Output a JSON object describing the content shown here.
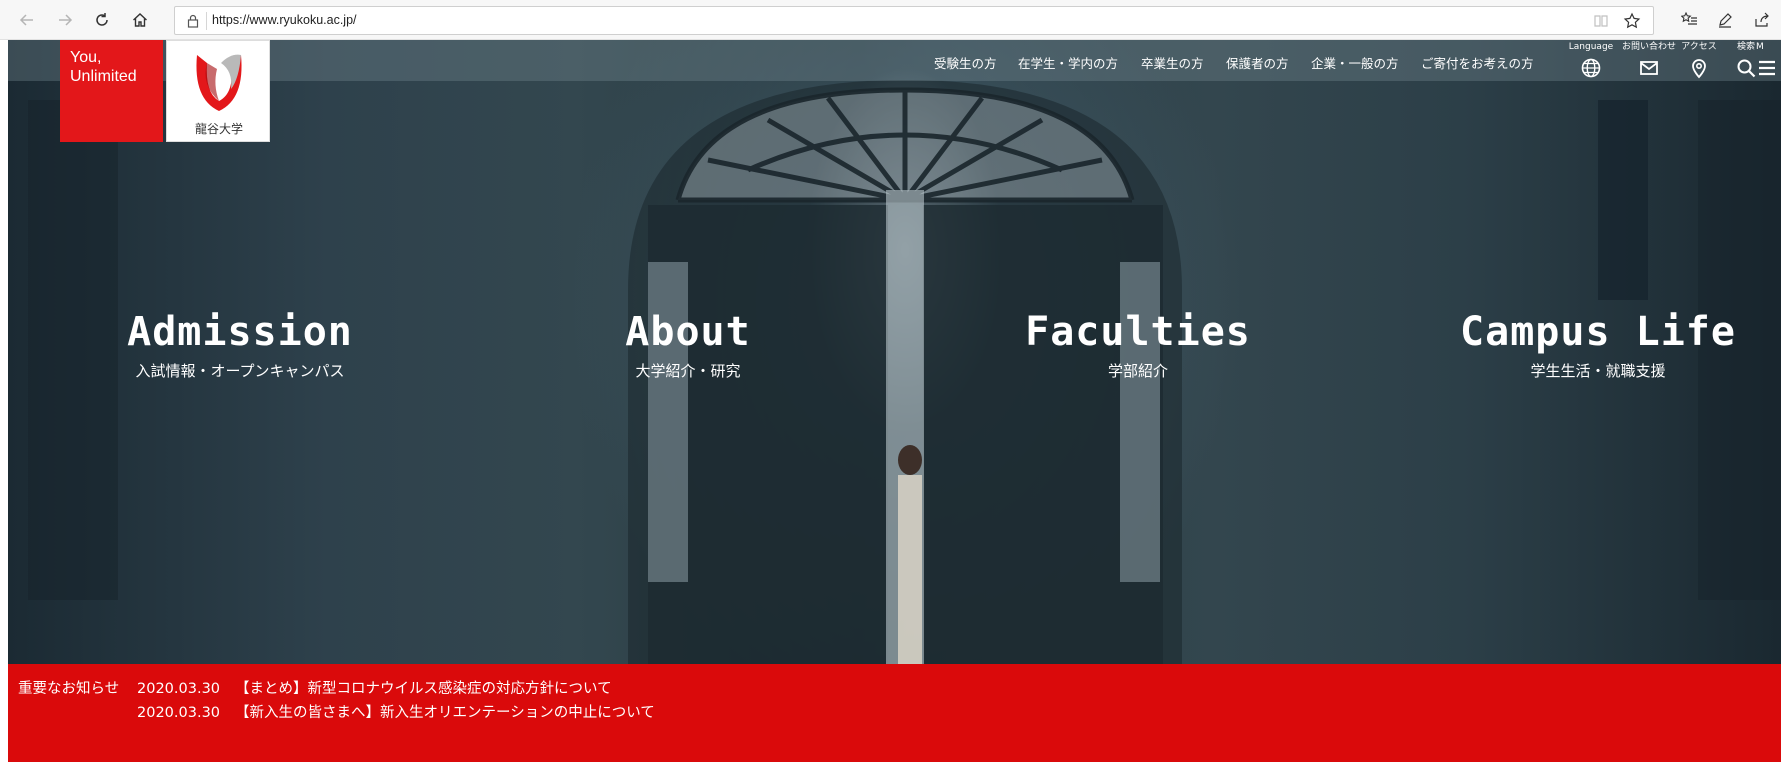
{
  "browser": {
    "url": "https://www.ryukoku.ac.jp/"
  },
  "site": {
    "tagline_line1": "You,",
    "tagline_line2": "Unlimited",
    "university_name": "龍谷大学"
  },
  "top_nav": [
    {
      "label": "受験生の方"
    },
    {
      "label": "在学生・学内の方"
    },
    {
      "label": "卒業生の方"
    },
    {
      "label": "保護者の方"
    },
    {
      "label": "企業・一般の方"
    },
    {
      "label": "ご寄付をお考えの方"
    }
  ],
  "utility": [
    {
      "label": "Language",
      "icon": "globe-icon"
    },
    {
      "label": "お問い合わせ",
      "icon": "mail-icon"
    },
    {
      "label": "アクセス",
      "icon": "map-pin-icon"
    },
    {
      "label": "検索",
      "icon": "search-icon"
    },
    {
      "label": "M",
      "icon": "menu-icon"
    }
  ],
  "hero_links": [
    {
      "en": "Admission",
      "ja": "入試情報・オープンキャンパス"
    },
    {
      "en": "About",
      "ja": "大学紹介・研究"
    },
    {
      "en": "Faculties",
      "ja": "学部紹介"
    },
    {
      "en": "Campus Life",
      "ja": "学生生活・就職支援"
    }
  ],
  "notice": {
    "heading": "重要なお知らせ",
    "items": [
      {
        "date": "2020.03.30",
        "text": "【まとめ】新型コロナウイルス感染症の対応方針について"
      },
      {
        "date": "2020.03.30",
        "text": "【新入生の皆さまへ】新入生オリエンテーションの中止について"
      }
    ]
  },
  "colors": {
    "brand_red": "#e3171a",
    "notice_red": "#da0a0b"
  }
}
